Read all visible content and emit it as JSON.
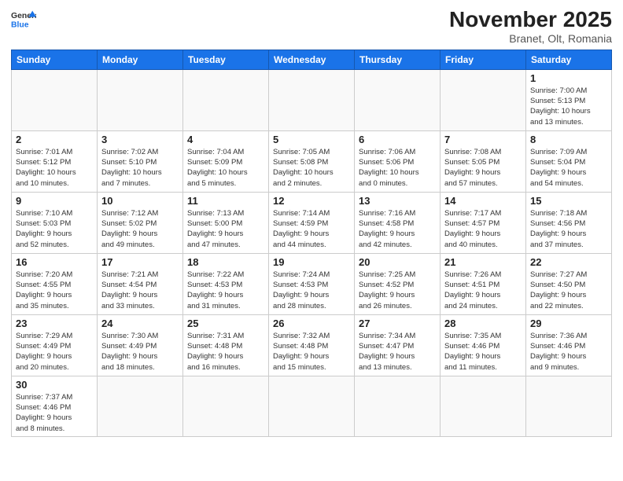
{
  "header": {
    "logo_general": "General",
    "logo_blue": "Blue",
    "month_title": "November 2025",
    "subtitle": "Branet, Olt, Romania"
  },
  "weekdays": [
    "Sunday",
    "Monday",
    "Tuesday",
    "Wednesday",
    "Thursday",
    "Friday",
    "Saturday"
  ],
  "weeks": [
    [
      {
        "day": "",
        "info": ""
      },
      {
        "day": "",
        "info": ""
      },
      {
        "day": "",
        "info": ""
      },
      {
        "day": "",
        "info": ""
      },
      {
        "day": "",
        "info": ""
      },
      {
        "day": "",
        "info": ""
      },
      {
        "day": "1",
        "info": "Sunrise: 7:00 AM\nSunset: 5:13 PM\nDaylight: 10 hours\nand 13 minutes."
      }
    ],
    [
      {
        "day": "2",
        "info": "Sunrise: 7:01 AM\nSunset: 5:12 PM\nDaylight: 10 hours\nand 10 minutes."
      },
      {
        "day": "3",
        "info": "Sunrise: 7:02 AM\nSunset: 5:10 PM\nDaylight: 10 hours\nand 7 minutes."
      },
      {
        "day": "4",
        "info": "Sunrise: 7:04 AM\nSunset: 5:09 PM\nDaylight: 10 hours\nand 5 minutes."
      },
      {
        "day": "5",
        "info": "Sunrise: 7:05 AM\nSunset: 5:08 PM\nDaylight: 10 hours\nand 2 minutes."
      },
      {
        "day": "6",
        "info": "Sunrise: 7:06 AM\nSunset: 5:06 PM\nDaylight: 10 hours\nand 0 minutes."
      },
      {
        "day": "7",
        "info": "Sunrise: 7:08 AM\nSunset: 5:05 PM\nDaylight: 9 hours\nand 57 minutes."
      },
      {
        "day": "8",
        "info": "Sunrise: 7:09 AM\nSunset: 5:04 PM\nDaylight: 9 hours\nand 54 minutes."
      }
    ],
    [
      {
        "day": "9",
        "info": "Sunrise: 7:10 AM\nSunset: 5:03 PM\nDaylight: 9 hours\nand 52 minutes."
      },
      {
        "day": "10",
        "info": "Sunrise: 7:12 AM\nSunset: 5:02 PM\nDaylight: 9 hours\nand 49 minutes."
      },
      {
        "day": "11",
        "info": "Sunrise: 7:13 AM\nSunset: 5:00 PM\nDaylight: 9 hours\nand 47 minutes."
      },
      {
        "day": "12",
        "info": "Sunrise: 7:14 AM\nSunset: 4:59 PM\nDaylight: 9 hours\nand 44 minutes."
      },
      {
        "day": "13",
        "info": "Sunrise: 7:16 AM\nSunset: 4:58 PM\nDaylight: 9 hours\nand 42 minutes."
      },
      {
        "day": "14",
        "info": "Sunrise: 7:17 AM\nSunset: 4:57 PM\nDaylight: 9 hours\nand 40 minutes."
      },
      {
        "day": "15",
        "info": "Sunrise: 7:18 AM\nSunset: 4:56 PM\nDaylight: 9 hours\nand 37 minutes."
      }
    ],
    [
      {
        "day": "16",
        "info": "Sunrise: 7:20 AM\nSunset: 4:55 PM\nDaylight: 9 hours\nand 35 minutes."
      },
      {
        "day": "17",
        "info": "Sunrise: 7:21 AM\nSunset: 4:54 PM\nDaylight: 9 hours\nand 33 minutes."
      },
      {
        "day": "18",
        "info": "Sunrise: 7:22 AM\nSunset: 4:53 PM\nDaylight: 9 hours\nand 31 minutes."
      },
      {
        "day": "19",
        "info": "Sunrise: 7:24 AM\nSunset: 4:53 PM\nDaylight: 9 hours\nand 28 minutes."
      },
      {
        "day": "20",
        "info": "Sunrise: 7:25 AM\nSunset: 4:52 PM\nDaylight: 9 hours\nand 26 minutes."
      },
      {
        "day": "21",
        "info": "Sunrise: 7:26 AM\nSunset: 4:51 PM\nDaylight: 9 hours\nand 24 minutes."
      },
      {
        "day": "22",
        "info": "Sunrise: 7:27 AM\nSunset: 4:50 PM\nDaylight: 9 hours\nand 22 minutes."
      }
    ],
    [
      {
        "day": "23",
        "info": "Sunrise: 7:29 AM\nSunset: 4:49 PM\nDaylight: 9 hours\nand 20 minutes."
      },
      {
        "day": "24",
        "info": "Sunrise: 7:30 AM\nSunset: 4:49 PM\nDaylight: 9 hours\nand 18 minutes."
      },
      {
        "day": "25",
        "info": "Sunrise: 7:31 AM\nSunset: 4:48 PM\nDaylight: 9 hours\nand 16 minutes."
      },
      {
        "day": "26",
        "info": "Sunrise: 7:32 AM\nSunset: 4:48 PM\nDaylight: 9 hours\nand 15 minutes."
      },
      {
        "day": "27",
        "info": "Sunrise: 7:34 AM\nSunset: 4:47 PM\nDaylight: 9 hours\nand 13 minutes."
      },
      {
        "day": "28",
        "info": "Sunrise: 7:35 AM\nSunset: 4:46 PM\nDaylight: 9 hours\nand 11 minutes."
      },
      {
        "day": "29",
        "info": "Sunrise: 7:36 AM\nSunset: 4:46 PM\nDaylight: 9 hours\nand 9 minutes."
      }
    ],
    [
      {
        "day": "30",
        "info": "Sunrise: 7:37 AM\nSunset: 4:46 PM\nDaylight: 9 hours\nand 8 minutes."
      },
      {
        "day": "",
        "info": ""
      },
      {
        "day": "",
        "info": ""
      },
      {
        "day": "",
        "info": ""
      },
      {
        "day": "",
        "info": ""
      },
      {
        "day": "",
        "info": ""
      },
      {
        "day": "",
        "info": ""
      }
    ]
  ]
}
